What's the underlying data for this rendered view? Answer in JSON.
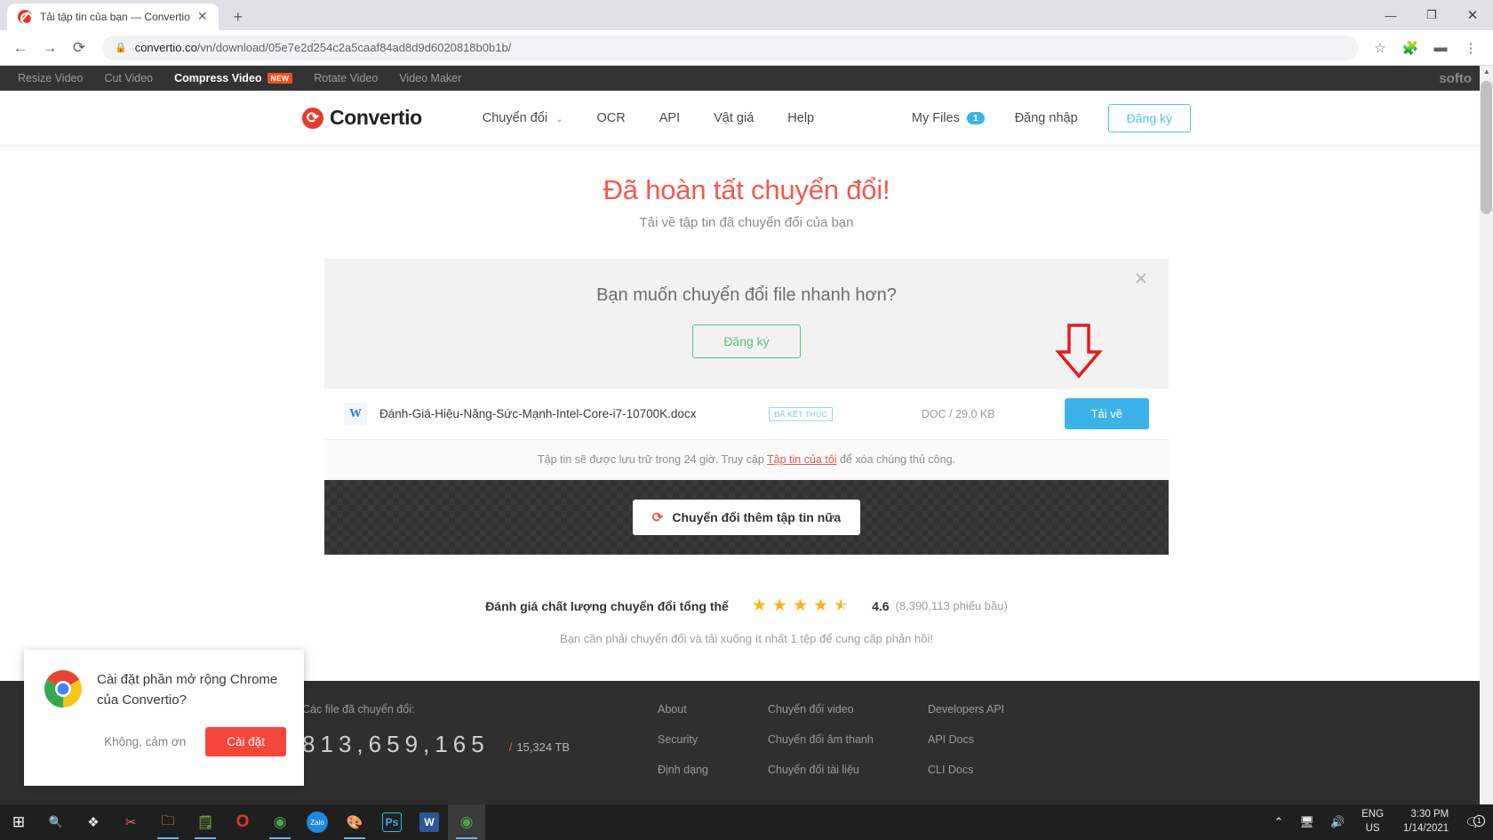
{
  "browser": {
    "tab_title": "Tải tập tin của bạn — Convertio",
    "tab_close": "✕",
    "new_tab": "+",
    "back": "←",
    "forward": "→",
    "reload": "⟳",
    "lock": "🔒",
    "url_domain": "convertio.co",
    "url_path": "/vn/download/05e7e2d254c2a5caaf84ad8d9d6020818b0b1b/",
    "star": "☆",
    "extension": "🧩",
    "profile": "▬",
    "menu": "⋮",
    "win_min": "—",
    "win_max": "❐",
    "win_close": "✕"
  },
  "site_topbar": {
    "links": [
      {
        "label": "Resize Video",
        "active": false,
        "badge": ""
      },
      {
        "label": "Cut Video",
        "active": false,
        "badge": ""
      },
      {
        "label": "Compress Video",
        "active": true,
        "badge": "NEW"
      },
      {
        "label": "Rotate Video",
        "active": false,
        "badge": ""
      },
      {
        "label": "Video Maker",
        "active": false,
        "badge": ""
      }
    ],
    "brand": "softo"
  },
  "header": {
    "logo_text": "Convertio",
    "nav": [
      {
        "label": "Chuyển đổi",
        "caret": "⌄"
      },
      {
        "label": "OCR",
        "caret": ""
      },
      {
        "label": "API",
        "caret": ""
      },
      {
        "label": "Vật giá",
        "caret": ""
      },
      {
        "label": "Help",
        "caret": ""
      }
    ],
    "my_files_label": "My Files",
    "my_files_count": "1",
    "sign_in": "Đăng nhập",
    "sign_up": "Đăng ký"
  },
  "hero": {
    "title": "Đã hoàn tất chuyển đổi!",
    "subtitle": "Tải về tập tin đã chuyển đổi của bạn"
  },
  "promo": {
    "title": "Bạn muốn chuyển đổi file nhanh hơn?",
    "cta": "Đăng ký",
    "close": "✕"
  },
  "file_row": {
    "icon_glyph": "W",
    "name": "Đánh-Giá-Hiệu-Năng-Sức-Mạnh-Intel-Core-i7-10700K.docx",
    "status": "ĐÃ KẾT THÚC",
    "meta": "DOC / 29.0 KB",
    "download_label": "Tải về"
  },
  "notice": {
    "before": "Tập tin sẽ được lưu trữ trong 24 giờ. Truy cập ",
    "link": "Tập tin của tôi",
    "after": " để xóa chúng thủ công."
  },
  "convert_more": {
    "icon": "⟳",
    "label": "Chuyển đổi thêm tập tin nữa"
  },
  "rating": {
    "label": "Đánh giá chất lượng chuyển đổi tổng thể",
    "stars": [
      "full",
      "full",
      "full",
      "full",
      "half"
    ],
    "star_glyph": "★",
    "value": "4.6",
    "votes": "(8,390,113 phiếu bầu)",
    "note": "Bạn cần phải chuyển đổi và tải xuống ít nhất 1 tệp để cung cấp phản hồi!"
  },
  "footer": {
    "counter_label": "Các file đã chuyển đổi:",
    "counter_digits": [
      "8",
      "1",
      "3",
      ",",
      "6",
      "5",
      "9",
      ",",
      "1",
      "6",
      "5"
    ],
    "counter_total_slash": "/",
    "counter_total": "15,324 TB",
    "columns": [
      {
        "links": [
          "About",
          "Security",
          "Định dạng"
        ]
      },
      {
        "links": [
          "Chuyển đổi video",
          "Chuyển đổi âm thanh",
          "Chuyển đổi tài liệu"
        ]
      },
      {
        "links": [
          "Developers API",
          "API Docs",
          "CLI Docs"
        ]
      }
    ]
  },
  "ext_popup": {
    "title": "Cài đặt phần mở rộng Chrome của Convertio?",
    "decline": "Không, cảm ơn",
    "accept": "Cài đặt"
  },
  "taskbar": {
    "start": "⊞",
    "search": "🔍",
    "items": [
      {
        "name": "task-view",
        "glyph": "❖",
        "color": "#e8e8e8",
        "active": false,
        "running": false
      },
      {
        "name": "snipping-tool",
        "glyph": "✂",
        "color": "#e86a6a",
        "active": false,
        "running": false
      },
      {
        "name": "file-explorer",
        "glyph": "🗀",
        "color": "#f2c14e",
        "active": false,
        "running": true
      },
      {
        "name": "notepad-editor",
        "glyph": "🗒",
        "color": "#8fc94e",
        "active": false,
        "running": true
      },
      {
        "name": "opera-browser",
        "glyph": "O",
        "color": "#e8342c",
        "active": false,
        "running": false
      },
      {
        "name": "chrome-browser",
        "glyph": "◉",
        "color": "#4ba24b",
        "active": false,
        "running": true
      },
      {
        "name": "zalo-app",
        "glyph": "Zalo",
        "color": "#1b8ae0",
        "active": false,
        "running": true
      },
      {
        "name": "paint-app",
        "glyph": "🎨",
        "color": "#d0609a",
        "active": false,
        "running": true
      },
      {
        "name": "photoshop-app",
        "glyph": "Ps",
        "color": "#2bb5e8",
        "active": false,
        "running": true
      },
      {
        "name": "word-app",
        "glyph": "W",
        "color": "#2b7cd3",
        "active": false,
        "running": true
      },
      {
        "name": "chrome-active",
        "glyph": "◉",
        "color": "#4ba24b",
        "active": true,
        "running": true
      }
    ],
    "tray_chevron": "⌃",
    "tray_network": "🖥",
    "tray_volume": "🔊",
    "lang_line1": "ENG",
    "lang_line2": "US",
    "clock_time": "3:30 PM",
    "clock_date": "1/14/2021",
    "notif_glyph": "🗨",
    "notif_count": "1"
  }
}
